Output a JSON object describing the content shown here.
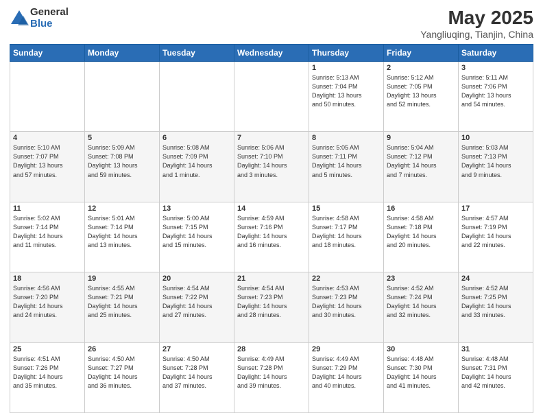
{
  "header": {
    "logo_general": "General",
    "logo_blue": "Blue",
    "title": "May 2025",
    "location": "Yangliuqing, Tianjin, China"
  },
  "days_of_week": [
    "Sunday",
    "Monday",
    "Tuesday",
    "Wednesday",
    "Thursday",
    "Friday",
    "Saturday"
  ],
  "weeks": [
    [
      {
        "num": "",
        "info": ""
      },
      {
        "num": "",
        "info": ""
      },
      {
        "num": "",
        "info": ""
      },
      {
        "num": "",
        "info": ""
      },
      {
        "num": "1",
        "info": "Sunrise: 5:13 AM\nSunset: 7:04 PM\nDaylight: 13 hours\nand 50 minutes."
      },
      {
        "num": "2",
        "info": "Sunrise: 5:12 AM\nSunset: 7:05 PM\nDaylight: 13 hours\nand 52 minutes."
      },
      {
        "num": "3",
        "info": "Sunrise: 5:11 AM\nSunset: 7:06 PM\nDaylight: 13 hours\nand 54 minutes."
      }
    ],
    [
      {
        "num": "4",
        "info": "Sunrise: 5:10 AM\nSunset: 7:07 PM\nDaylight: 13 hours\nand 57 minutes."
      },
      {
        "num": "5",
        "info": "Sunrise: 5:09 AM\nSunset: 7:08 PM\nDaylight: 13 hours\nand 59 minutes."
      },
      {
        "num": "6",
        "info": "Sunrise: 5:08 AM\nSunset: 7:09 PM\nDaylight: 14 hours\nand 1 minute."
      },
      {
        "num": "7",
        "info": "Sunrise: 5:06 AM\nSunset: 7:10 PM\nDaylight: 14 hours\nand 3 minutes."
      },
      {
        "num": "8",
        "info": "Sunrise: 5:05 AM\nSunset: 7:11 PM\nDaylight: 14 hours\nand 5 minutes."
      },
      {
        "num": "9",
        "info": "Sunrise: 5:04 AM\nSunset: 7:12 PM\nDaylight: 14 hours\nand 7 minutes."
      },
      {
        "num": "10",
        "info": "Sunrise: 5:03 AM\nSunset: 7:13 PM\nDaylight: 14 hours\nand 9 minutes."
      }
    ],
    [
      {
        "num": "11",
        "info": "Sunrise: 5:02 AM\nSunset: 7:14 PM\nDaylight: 14 hours\nand 11 minutes."
      },
      {
        "num": "12",
        "info": "Sunrise: 5:01 AM\nSunset: 7:14 PM\nDaylight: 14 hours\nand 13 minutes."
      },
      {
        "num": "13",
        "info": "Sunrise: 5:00 AM\nSunset: 7:15 PM\nDaylight: 14 hours\nand 15 minutes."
      },
      {
        "num": "14",
        "info": "Sunrise: 4:59 AM\nSunset: 7:16 PM\nDaylight: 14 hours\nand 16 minutes."
      },
      {
        "num": "15",
        "info": "Sunrise: 4:58 AM\nSunset: 7:17 PM\nDaylight: 14 hours\nand 18 minutes."
      },
      {
        "num": "16",
        "info": "Sunrise: 4:58 AM\nSunset: 7:18 PM\nDaylight: 14 hours\nand 20 minutes."
      },
      {
        "num": "17",
        "info": "Sunrise: 4:57 AM\nSunset: 7:19 PM\nDaylight: 14 hours\nand 22 minutes."
      }
    ],
    [
      {
        "num": "18",
        "info": "Sunrise: 4:56 AM\nSunset: 7:20 PM\nDaylight: 14 hours\nand 24 minutes."
      },
      {
        "num": "19",
        "info": "Sunrise: 4:55 AM\nSunset: 7:21 PM\nDaylight: 14 hours\nand 25 minutes."
      },
      {
        "num": "20",
        "info": "Sunrise: 4:54 AM\nSunset: 7:22 PM\nDaylight: 14 hours\nand 27 minutes."
      },
      {
        "num": "21",
        "info": "Sunrise: 4:54 AM\nSunset: 7:23 PM\nDaylight: 14 hours\nand 28 minutes."
      },
      {
        "num": "22",
        "info": "Sunrise: 4:53 AM\nSunset: 7:23 PM\nDaylight: 14 hours\nand 30 minutes."
      },
      {
        "num": "23",
        "info": "Sunrise: 4:52 AM\nSunset: 7:24 PM\nDaylight: 14 hours\nand 32 minutes."
      },
      {
        "num": "24",
        "info": "Sunrise: 4:52 AM\nSunset: 7:25 PM\nDaylight: 14 hours\nand 33 minutes."
      }
    ],
    [
      {
        "num": "25",
        "info": "Sunrise: 4:51 AM\nSunset: 7:26 PM\nDaylight: 14 hours\nand 35 minutes."
      },
      {
        "num": "26",
        "info": "Sunrise: 4:50 AM\nSunset: 7:27 PM\nDaylight: 14 hours\nand 36 minutes."
      },
      {
        "num": "27",
        "info": "Sunrise: 4:50 AM\nSunset: 7:28 PM\nDaylight: 14 hours\nand 37 minutes."
      },
      {
        "num": "28",
        "info": "Sunrise: 4:49 AM\nSunset: 7:28 PM\nDaylight: 14 hours\nand 39 minutes."
      },
      {
        "num": "29",
        "info": "Sunrise: 4:49 AM\nSunset: 7:29 PM\nDaylight: 14 hours\nand 40 minutes."
      },
      {
        "num": "30",
        "info": "Sunrise: 4:48 AM\nSunset: 7:30 PM\nDaylight: 14 hours\nand 41 minutes."
      },
      {
        "num": "31",
        "info": "Sunrise: 4:48 AM\nSunset: 7:31 PM\nDaylight: 14 hours\nand 42 minutes."
      }
    ]
  ]
}
